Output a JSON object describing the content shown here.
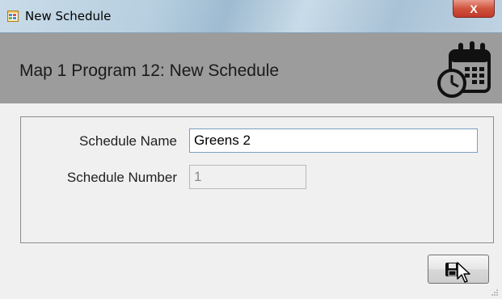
{
  "window": {
    "title": "New Schedule",
    "close_label": "X"
  },
  "header": {
    "title": "Map 1 Program 12: New Schedule",
    "icon": "calendar-clock-icon"
  },
  "form": {
    "schedule_name": {
      "label": "Schedule Name",
      "value": "Greens 2"
    },
    "schedule_number": {
      "label": "Schedule Number",
      "value": "1"
    }
  },
  "actions": {
    "save_icon": "save-icon"
  }
}
